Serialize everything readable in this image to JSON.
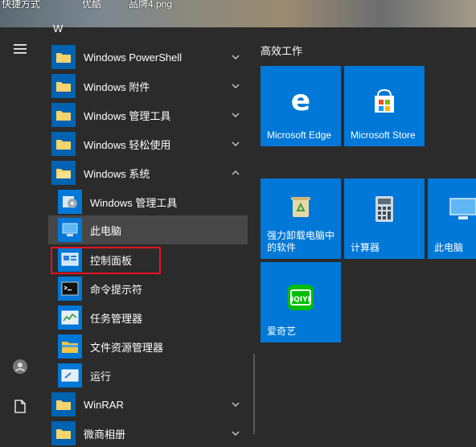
{
  "desktop": {
    "icons": [
      "快捷方式",
      "优酷",
      "品牌4.png"
    ]
  },
  "menu": {
    "hamburger_icon": "hamburger-icon",
    "letter_header": "W",
    "apps": [
      {
        "label": "Windows PowerShell",
        "expanded": false
      },
      {
        "label": "Windows 附件",
        "expanded": false
      },
      {
        "label": "Windows 管理工具",
        "expanded": false
      },
      {
        "label": "Windows 轻松使用",
        "expanded": false
      },
      {
        "label": "Windows 系统",
        "expanded": true
      }
    ],
    "system_items": [
      {
        "label": "Windows 管理工具",
        "icon": "admin-tools-icon"
      },
      {
        "label": "此电脑",
        "icon": "this-pc-icon"
      },
      {
        "label": "控制面板",
        "icon": "control-panel-icon"
      },
      {
        "label": "命令提示符",
        "icon": "cmd-icon"
      },
      {
        "label": "任务管理器",
        "icon": "task-manager-icon"
      },
      {
        "label": "文件资源管理器",
        "icon": "file-explorer-icon"
      },
      {
        "label": "运行",
        "icon": "run-icon"
      }
    ],
    "after_apps": [
      {
        "label": "WinRAR",
        "expanded": false
      },
      {
        "label": "微商相册",
        "expanded": false
      }
    ],
    "highlighted_item": "控制面板"
  },
  "tiles": {
    "group_title": "高效工作",
    "items": [
      {
        "label": "Microsoft Edge",
        "icon": "edge-icon"
      },
      {
        "label": "Microsoft Store",
        "icon": "store-icon"
      },
      {
        "label_line1": "强力卸载电脑中",
        "label_line2": "的软件",
        "icon": "recycle-bin-icon"
      },
      {
        "label": "计算器",
        "icon": "calculator-icon"
      },
      {
        "label": "此电脑",
        "icon": "this-pc-icon"
      },
      {
        "label": "爱奇艺",
        "icon": "iqiyi-icon"
      }
    ]
  },
  "colors": {
    "menu_bg": "#2b2b2b",
    "tile_blue": "#0078d7",
    "folder_tile": "#0063b1",
    "highlight_border": "#e81123",
    "iqiyi_green": "#00be06"
  }
}
